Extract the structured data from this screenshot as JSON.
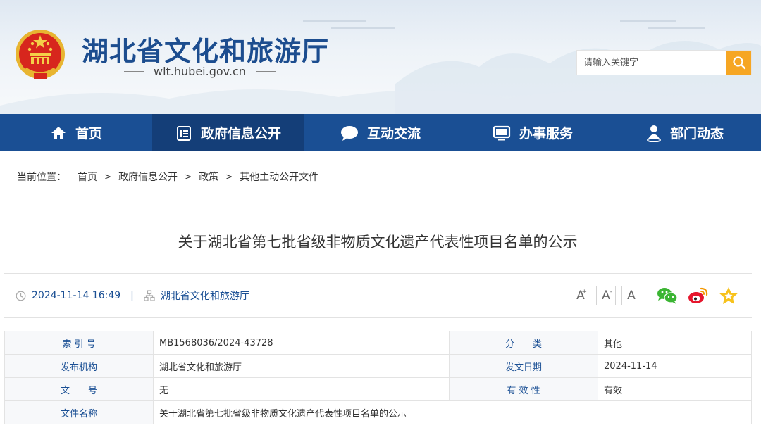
{
  "header": {
    "site_title": "湖北省文化和旅游厅",
    "site_domain": "wlt.hubei.gov.cn",
    "search_placeholder": "请输入关键字"
  },
  "nav": {
    "items": [
      {
        "label": "首页",
        "icon": "home-icon"
      },
      {
        "label": "政府信息公开",
        "icon": "document-list-icon"
      },
      {
        "label": "互动交流",
        "icon": "chat-bubble-icon"
      },
      {
        "label": "办事服务",
        "icon": "monitor-icon"
      },
      {
        "label": "部门动态",
        "icon": "person-pin-icon"
      }
    ],
    "active_index": 1
  },
  "breadcrumb": {
    "label": "当前位置：",
    "items": [
      "首页",
      "政府信息公开",
      "政策",
      "其他主动公开文件"
    ],
    "separator": ">"
  },
  "article": {
    "title": "关于湖北省第七批省级非物质文化遗产代表性项目名单的公示",
    "datetime": "2024-11-14 16:49",
    "meta_separator": "|",
    "source": "湖北省文化和旅游厅"
  },
  "tools": {
    "font_buttons": [
      "A",
      "A",
      "A"
    ],
    "font_button_marks": [
      "+",
      "-",
      ""
    ],
    "share": [
      "wechat-icon",
      "weibo-icon",
      "favorite-star-icon"
    ]
  },
  "info_table": {
    "rows": [
      [
        {
          "key": "索 引 号",
          "value": "MB1568036/2024-43728"
        },
        {
          "key": "分　　类",
          "value": "其他"
        }
      ],
      [
        {
          "key": "发布机构",
          "value": "湖北省文化和旅游厅"
        },
        {
          "key": "发文日期",
          "value": "2024-11-14"
        }
      ],
      [
        {
          "key": "文　　号",
          "value": "无"
        },
        {
          "key": "有 效 性",
          "value": "有效"
        }
      ]
    ],
    "title_row": {
      "key": "文件名称",
      "value": "关于湖北省第七批省级非物质文化遗产代表性项目名单的公示"
    }
  },
  "colors": {
    "nav_bg": "#1a4f94",
    "nav_active": "#143e78",
    "brand_blue": "#1c4d8f",
    "search_button": "#f6a623"
  }
}
